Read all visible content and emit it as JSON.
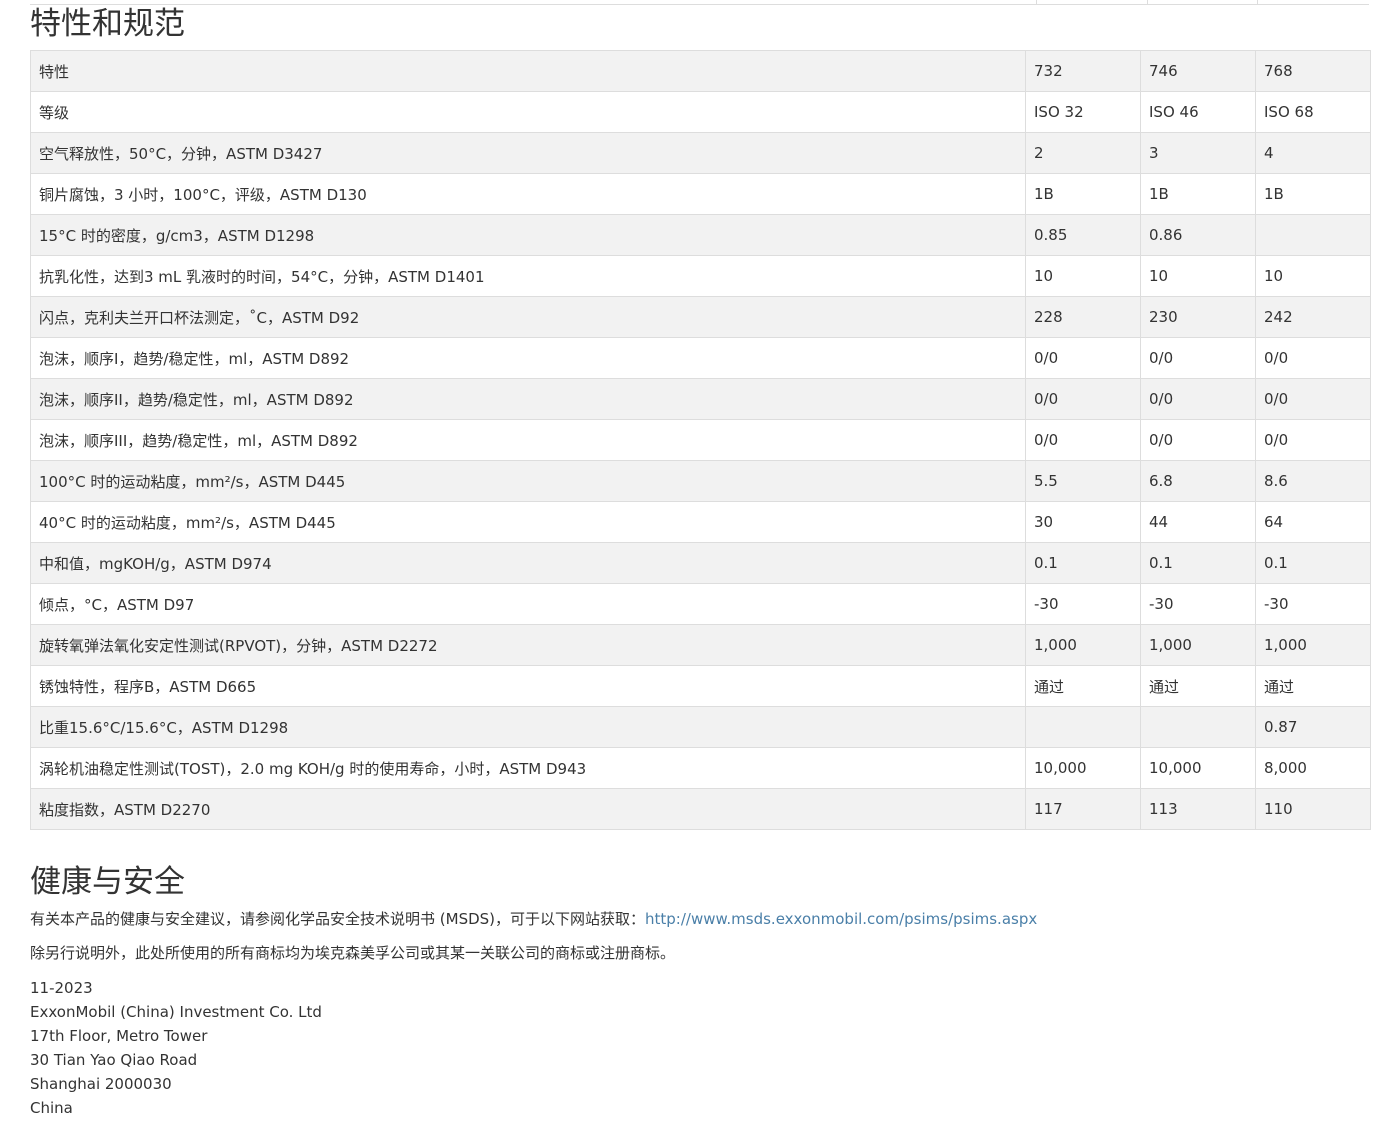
{
  "specs": {
    "title": "特性和规范",
    "table": {
      "rows": [
        [
          "特性",
          "732",
          "746",
          "768"
        ],
        [
          "等级",
          "ISO 32",
          "ISO 46",
          "ISO 68"
        ],
        [
          "空气释放性，50°C，分钟，ASTM D3427",
          "2",
          "3",
          "4"
        ],
        [
          "铜片腐蚀，3 小时，100°C，评级，ASTM D130",
          "1B",
          "1B",
          "1B"
        ],
        [
          "15°C 时的密度，g/cm3，ASTM D1298",
          "0.85",
          "0.86",
          ""
        ],
        [
          "抗乳化性，达到3 mL 乳液时的时间，54°C，分钟，ASTM D1401",
          "10",
          "10",
          "10"
        ],
        [
          "闪点，克利夫兰开口杯法测定，˚C，ASTM D92",
          "228",
          "230",
          "242"
        ],
        [
          "泡沫，顺序I，趋势/稳定性，ml，ASTM D892",
          "0/0",
          "0/0",
          "0/0"
        ],
        [
          "泡沫，顺序II，趋势/稳定性，ml，ASTM D892",
          "0/0",
          "0/0",
          "0/0"
        ],
        [
          "泡沫，顺序III，趋势/稳定性，ml，ASTM D892",
          "0/0",
          "0/0",
          "0/0"
        ],
        [
          "100°C 时的运动粘度，mm²/s，ASTM D445",
          "5.5",
          "6.8",
          "8.6"
        ],
        [
          "40°C 时的运动粘度，mm²/s，ASTM D445",
          "30",
          "44",
          "64"
        ],
        [
          "中和值，mgKOH/g，ASTM D974",
          "0.1",
          "0.1",
          "0.1"
        ],
        [
          "倾点，°C，ASTM D97",
          "-30",
          "-30",
          "-30"
        ],
        [
          "旋转氧弹法氧化安定性测试(RPVOT)，分钟，ASTM D2272",
          "1,000",
          "1,000",
          "1,000"
        ],
        [
          "锈蚀特性，程序B，ASTM D665",
          "通过",
          "通过",
          "通过"
        ],
        [
          "比重15.6°C/15.6°C，ASTM D1298",
          "",
          "",
          "0.87"
        ],
        [
          "涡轮机油稳定性测试(TOST)，2.0 mg KOH/g 时的使用寿命，小时，ASTM D943",
          "10,000",
          "10,000",
          "8,000"
        ],
        [
          "粘度指数，ASTM D2270",
          "117",
          "113",
          "110"
        ]
      ]
    }
  },
  "health": {
    "title": "健康与安全",
    "safety_text": "有关本产品的健康与安全建议，请参阅化学品安全技术说明书 (MSDS)，可于以下网站获取：",
    "msds_link": "http://www.msds.exxonmobil.com/psims/psims.aspx",
    "trademark_text": "除另行说明外，此处所使用的所有商标均为埃克森美孚公司或其某一关联公司的商标或注册商标。"
  },
  "footer": {
    "date": "11-2023",
    "company": "ExxonMobil (China) Investment Co. Ltd",
    "address_lines": [
      "17th Floor, Metro Tower",
      "30 Tian Yao Qiao Road",
      "Shanghai 2000030",
      "China"
    ]
  },
  "colors": {
    "text": "#333333",
    "link": "#4a7fa8",
    "row_alt": "#f2f2f2",
    "border": "#dddddd"
  }
}
